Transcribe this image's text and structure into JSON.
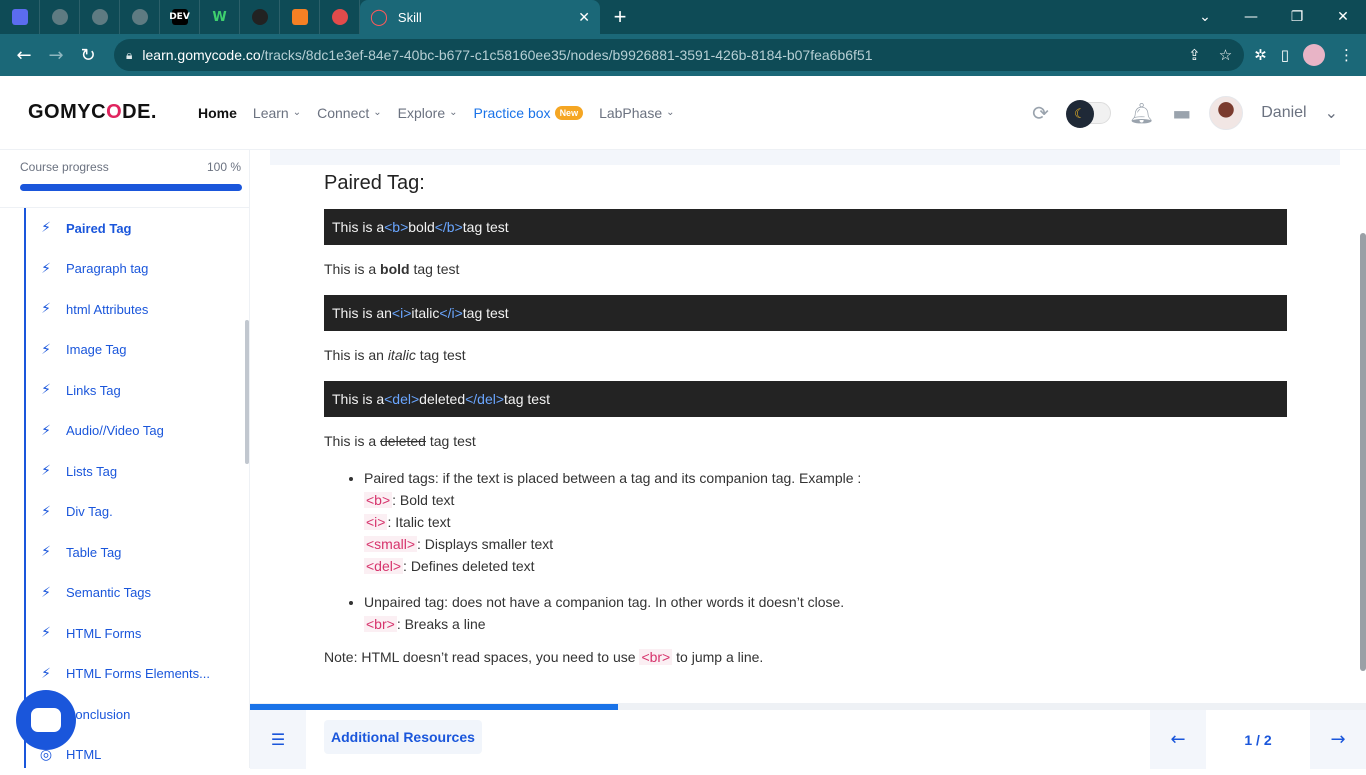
{
  "browser": {
    "tab_title": "Skill",
    "url_host": "learn.gomycode.co",
    "url_path": "/tracks/8dc1e3ef-84e7-40bc-b677-c1c58160ee35/nodes/b9926881-3591-426b-8184-b07fea6b6f51",
    "pinned_tabs": [
      "app-icon",
      "globe-icon",
      "globe-icon",
      "globe-icon",
      "dev-icon",
      "w-icon",
      "github-icon",
      "stack-icon",
      "settings-icon"
    ],
    "dev_label": "DEV",
    "w_label": "W"
  },
  "header": {
    "logo": "GOMYC",
    "logo_o": "O",
    "logo_tail": "DE.",
    "nav": {
      "home": "Home",
      "learn": "Learn",
      "connect": "Connect",
      "explore": "Explore",
      "practice": "Practice box",
      "practice_badge": "New",
      "labphase": "LabPhase"
    },
    "user": "Daniel"
  },
  "sidebar": {
    "progress_label": "Course progress",
    "progress_value": "100 %",
    "progress_fraction": 1.0,
    "lessons": [
      "Paired Tag",
      "Paragraph tag",
      "html Attributes",
      "Image Tag",
      "Links Tag",
      "Audio//Video Tag",
      "Lists Tag",
      "Div Tag.",
      "Table Tag",
      "Semantic Tags",
      "HTML Forms",
      "HTML Forms Elements...",
      "Conclusion",
      "HTML"
    ]
  },
  "content": {
    "title": "Paired Tag:",
    "code1": {
      "pre": "This is a ",
      "open": "<b>",
      "mid": "bold",
      "close": "</b>",
      "post": " tag test"
    },
    "para1": {
      "pre": "This is a ",
      "strong": "bold",
      "post": " tag test"
    },
    "code2": {
      "pre": "This is an ",
      "open": "<i>",
      "mid": "italic",
      "close": "</i>",
      "post": " tag test"
    },
    "para2": {
      "pre": "This is an ",
      "em": "italic",
      "post": " tag test"
    },
    "code3": {
      "pre": "This is a ",
      "open": "<del>",
      "mid": "deleted",
      "close": "</del>",
      "post": " tag test"
    },
    "para3": {
      "pre": "This is a ",
      "del": "deleted",
      "post": " tag test"
    },
    "bullet1": {
      "lead": "Paired tags: if the text is placed between a tag and its companion tag. Example :",
      "items": [
        {
          "tag": "<b>",
          "desc": ": Bold text"
        },
        {
          "tag": "<i>",
          "desc": ": Italic text"
        },
        {
          "tag": "<small>",
          "desc": ": Displays smaller text"
        },
        {
          "tag": "<del>",
          "desc": ": Defines deleted text"
        }
      ]
    },
    "bullet2": {
      "lead": "Unpaired tag: does not have a companion tag. In other words it doesn’t close.",
      "tag": "<br>",
      "desc": ": Breaks a line"
    },
    "note": {
      "pre": "Note: HTML doesn’t read spaces, you need to use ",
      "tag": "<br>",
      "post": " to jump a line."
    }
  },
  "footer": {
    "resources": "Additional Resources",
    "pager": "1 / 2",
    "progress_fraction": 0.33
  }
}
